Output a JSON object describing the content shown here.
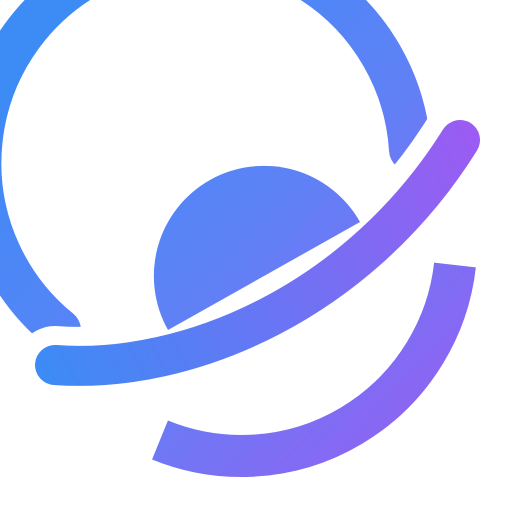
{
  "icon": {
    "name": "planet-icon",
    "colors": {
      "gradient_start": "#3D8BF5",
      "gradient_mid": "#5E82F6",
      "gradient_end": "#9A5CF2",
      "background": "#FFFFFF"
    }
  }
}
